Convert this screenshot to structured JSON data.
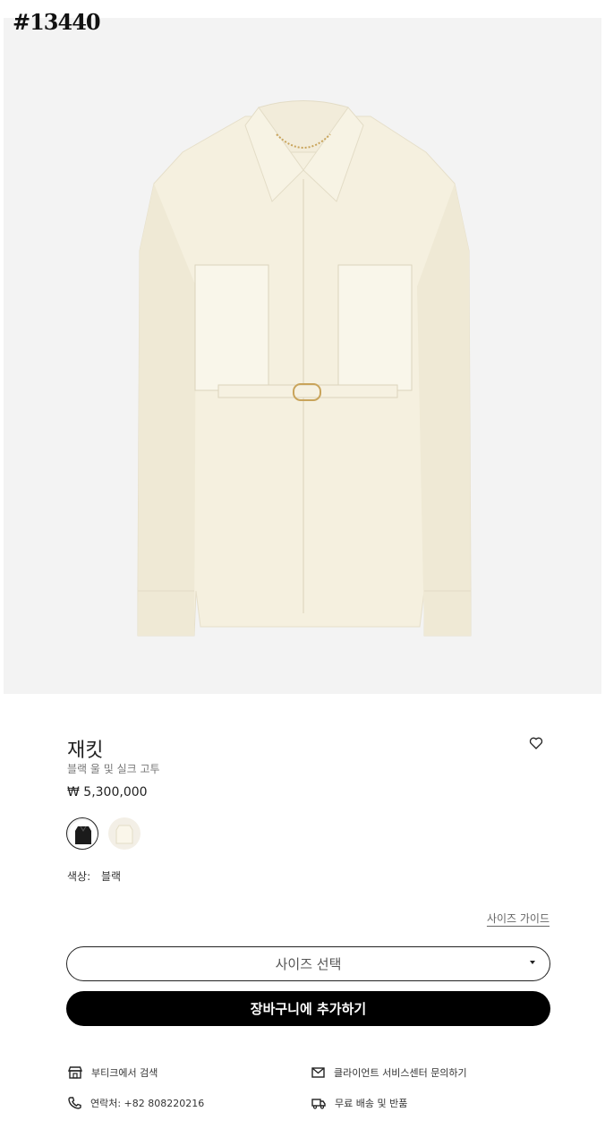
{
  "stamp": "#13440",
  "product": {
    "name": "재킷",
    "material": "블랙 울 및 실크 고투",
    "price": "₩ 5,300,000"
  },
  "colors": {
    "label": "색상:",
    "selected": "블랙",
    "swatches": [
      "black",
      "ivory"
    ]
  },
  "size_guide_label": "사이즈 가이드",
  "size_select_label": "사이즈 선택",
  "add_to_cart_label": "장바구니에 추가하기",
  "links": {
    "boutique": "부티크에서 검색",
    "client_service": "클라이언트 서비스센터 문의하기",
    "contact": "연락처: +82 808220216",
    "shipping": "무료 배송 및 반품"
  },
  "accent_colors": {
    "button": "#000000",
    "jacket": "#f4efdf",
    "image_bg": "#f3f3f3"
  }
}
